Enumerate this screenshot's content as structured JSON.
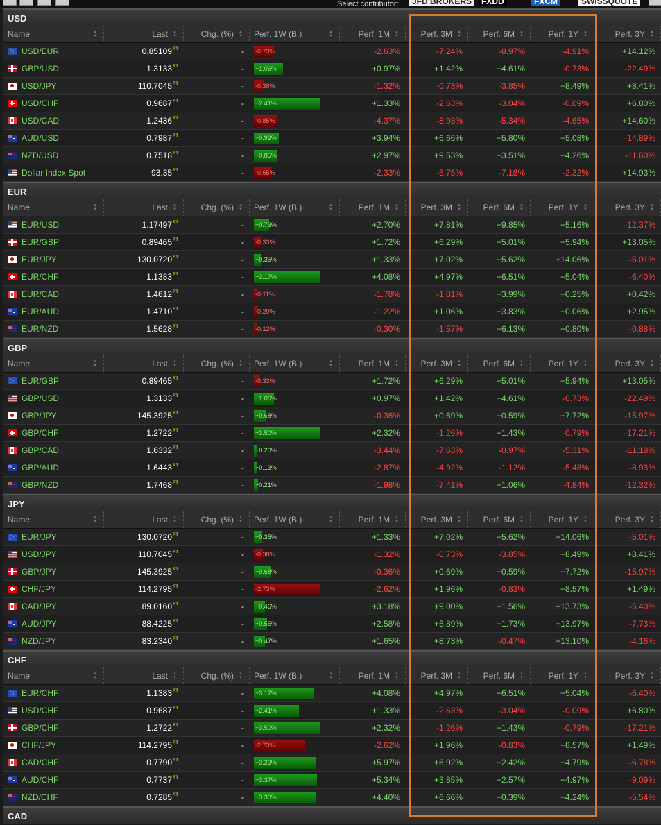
{
  "toolbar": {
    "contributor_label": "Select contributor:",
    "contributors": [
      "JFD BROKERS",
      "FXDD",
      "FXCM",
      "SWISSQUOTE"
    ]
  },
  "columns": [
    "Name",
    "Last",
    "Chg. (%)",
    "Perf. 1W (B.)",
    "Perf. 1M",
    "Perf. 3M",
    "Perf. 6M",
    "Perf. 1Y",
    "Perf. 3Y"
  ],
  "rt_label": "RT",
  "colors": {
    "up": "#79d36a",
    "down": "#ff4444",
    "highlight": "#d97b2c"
  },
  "sections": [
    {
      "title": "USD",
      "rows": [
        {
          "flag": "eu",
          "name": "USD/EUR",
          "last": "0.85109",
          "chg": "-",
          "w1": "-0.73%",
          "m1": "-2.63%",
          "m3": "-7.24%",
          "m6": "-8.97%",
          "y1": "-4.91%",
          "y3": "+14.12%"
        },
        {
          "flag": "gb",
          "name": "GBP/USD",
          "last": "1.3133",
          "chg": "-",
          "w1": "+1.06%",
          "m1": "+0.97%",
          "m3": "+1.42%",
          "m6": "+4.61%",
          "y1": "-0.73%",
          "y3": "-22.49%"
        },
        {
          "flag": "jp",
          "name": "USD/JPY",
          "last": "110.7045",
          "chg": "-",
          "w1": "-0.38%",
          "m1": "-1.32%",
          "m3": "-0.73%",
          "m6": "-3.85%",
          "y1": "+8.49%",
          "y3": "+8.41%"
        },
        {
          "flag": "ch",
          "name": "USD/CHF",
          "last": "0.9687",
          "chg": "-",
          "w1": "+2.41%",
          "m1": "+1.33%",
          "m3": "-2.63%",
          "m6": "-3.04%",
          "y1": "-0.09%",
          "y3": "+6.80%"
        },
        {
          "flag": "ca",
          "name": "USD/CAD",
          "last": "1.2436",
          "chg": "-",
          "w1": "-0.85%",
          "m1": "-4.37%",
          "m3": "-8.93%",
          "m6": "-5.34%",
          "y1": "-4.65%",
          "y3": "+14.60%"
        },
        {
          "flag": "au",
          "name": "AUD/USD",
          "last": "0.7987",
          "chg": "-",
          "w1": "+0.92%",
          "m1": "+3.94%",
          "m3": "+6.66%",
          "m6": "+5.80%",
          "y1": "+5.08%",
          "y3": "-14.89%"
        },
        {
          "flag": "nz",
          "name": "NZD/USD",
          "last": "0.7518",
          "chg": "-",
          "w1": "+0.85%",
          "m1": "+2.97%",
          "m3": "+9.53%",
          "m6": "+3.51%",
          "y1": "+4.26%",
          "y3": "-11.60%"
        },
        {
          "flag": "us",
          "name": "Dollar Index Spot",
          "last": "93.35",
          "chg": "-",
          "w1": "-0.65%",
          "m1": "-2.33%",
          "m3": "-5.75%",
          "m6": "-7.18%",
          "y1": "-2.32%",
          "y3": "+14.93%"
        }
      ]
    },
    {
      "title": "EUR",
      "rows": [
        {
          "flag": "us",
          "name": "EUR/USD",
          "last": "1.17497",
          "chg": "-",
          "w1": "+0.73%",
          "m1": "+2.70%",
          "m3": "+7.81%",
          "m6": "+9.85%",
          "y1": "+5.16%",
          "y3": "-12.37%"
        },
        {
          "flag": "gb",
          "name": "EUR/GBP",
          "last": "0.89465",
          "chg": "-",
          "w1": "-0.33%",
          "m1": "+1.72%",
          "m3": "+6.29%",
          "m6": "+5.01%",
          "y1": "+5.94%",
          "y3": "+13.05%"
        },
        {
          "flag": "jp",
          "name": "EUR/JPY",
          "last": "130.0720",
          "chg": "-",
          "w1": "+0.35%",
          "m1": "+1.33%",
          "m3": "+7.02%",
          "m6": "+5.62%",
          "y1": "+14.06%",
          "y3": "-5.01%"
        },
        {
          "flag": "ch",
          "name": "EUR/CHF",
          "last": "1.1383",
          "chg": "-",
          "w1": "+3.17%",
          "m1": "+4.08%",
          "m3": "+4.97%",
          "m6": "+6.51%",
          "y1": "+5.04%",
          "y3": "-6.40%"
        },
        {
          "flag": "ca",
          "name": "EUR/CAD",
          "last": "1.4612",
          "chg": "-",
          "w1": "-0.11%",
          "m1": "-1.78%",
          "m3": "-1.81%",
          "m6": "+3.99%",
          "y1": "+0.25%",
          "y3": "+0.42%"
        },
        {
          "flag": "au",
          "name": "EUR/AUD",
          "last": "1.4710",
          "chg": "-",
          "w1": "-0.20%",
          "m1": "-1.22%",
          "m3": "+1.06%",
          "m6": "+3.83%",
          "y1": "+0.06%",
          "y3": "+2.95%"
        },
        {
          "flag": "nz",
          "name": "EUR/NZD",
          "last": "1.5628",
          "chg": "-",
          "w1": "-0.12%",
          "m1": "-0.30%",
          "m3": "-1.57%",
          "m6": "+6.13%",
          "y1": "+0.80%",
          "y3": "-0.88%"
        }
      ]
    },
    {
      "title": "GBP",
      "rows": [
        {
          "flag": "eu",
          "name": "EUR/GBP",
          "last": "0.89465",
          "chg": "-",
          "w1": "-0.33%",
          "m1": "+1.72%",
          "m3": "+6.29%",
          "m6": "+5.01%",
          "y1": "+5.94%",
          "y3": "+13.05%"
        },
        {
          "flag": "us",
          "name": "GBP/USD",
          "last": "1.3133",
          "chg": "-",
          "w1": "+1.06%",
          "m1": "+0.97%",
          "m3": "+1.42%",
          "m6": "+4.61%",
          "y1": "-0.73%",
          "y3": "-22.49%"
        },
        {
          "flag": "jp",
          "name": "GBP/JPY",
          "last": "145.3925",
          "chg": "-",
          "w1": "+0.68%",
          "m1": "-0.36%",
          "m3": "+0.69%",
          "m6": "+0.59%",
          "y1": "+7.72%",
          "y3": "-15.97%"
        },
        {
          "flag": "ch",
          "name": "GBP/CHF",
          "last": "1.2722",
          "chg": "-",
          "w1": "+3.50%",
          "m1": "+2.32%",
          "m3": "-1.26%",
          "m6": "+1.43%",
          "y1": "-0.79%",
          "y3": "-17.21%"
        },
        {
          "flag": "ca",
          "name": "GBP/CAD",
          "last": "1.6332",
          "chg": "-",
          "w1": "+0.20%",
          "m1": "-3.44%",
          "m3": "-7.63%",
          "m6": "-0.97%",
          "y1": "-5.31%",
          "y3": "-11.18%"
        },
        {
          "flag": "au",
          "name": "GBP/AUD",
          "last": "1.6443",
          "chg": "-",
          "w1": "+0.13%",
          "m1": "-2.87%",
          "m3": "-4.92%",
          "m6": "-1.12%",
          "y1": "-5.48%",
          "y3": "-8.93%"
        },
        {
          "flag": "nz",
          "name": "GBP/NZD",
          "last": "1.7468",
          "chg": "-",
          "w1": "+0.21%",
          "m1": "-1.98%",
          "m3": "-7.41%",
          "m6": "+1.06%",
          "y1": "-4.84%",
          "y3": "-12.32%"
        }
      ]
    },
    {
      "title": "JPY",
      "rows": [
        {
          "flag": "eu",
          "name": "EUR/JPY",
          "last": "130.0720",
          "chg": "-",
          "w1": "+0.35%",
          "m1": "+1.33%",
          "m3": "+7.02%",
          "m6": "+5.62%",
          "y1": "+14.06%",
          "y3": "-5.01%"
        },
        {
          "flag": "us",
          "name": "USD/JPY",
          "last": "110.7045",
          "chg": "-",
          "w1": "-0.38%",
          "m1": "-1.32%",
          "m3": "-0.73%",
          "m6": "-3.85%",
          "y1": "+8.49%",
          "y3": "+8.41%"
        },
        {
          "flag": "gb",
          "name": "GBP/JPY",
          "last": "145.3925",
          "chg": "-",
          "w1": "+0.68%",
          "m1": "-0.36%",
          "m3": "+0.69%",
          "m6": "+0.59%",
          "y1": "+7.72%",
          "y3": "-15.97%"
        },
        {
          "flag": "ch",
          "name": "CHF/JPY",
          "last": "114.2795",
          "chg": "-",
          "w1": "-2.73%",
          "m1": "-2.62%",
          "m3": "+1.96%",
          "m6": "-0.83%",
          "y1": "+8.57%",
          "y3": "+1.49%"
        },
        {
          "flag": "ca",
          "name": "CAD/JPY",
          "last": "89.0160",
          "chg": "-",
          "w1": "+0.46%",
          "m1": "+3.18%",
          "m3": "+9.00%",
          "m6": "+1.56%",
          "y1": "+13.73%",
          "y3": "-5.40%"
        },
        {
          "flag": "au",
          "name": "AUD/JPY",
          "last": "88.4225",
          "chg": "-",
          "w1": "+0.55%",
          "m1": "+2.58%",
          "m3": "+5.89%",
          "m6": "+1.73%",
          "y1": "+13.97%",
          "y3": "-7.73%"
        },
        {
          "flag": "nz",
          "name": "NZD/JPY",
          "last": "83.2340",
          "chg": "-",
          "w1": "+0.47%",
          "m1": "+1.65%",
          "m3": "+8.73%",
          "m6": "-0.47%",
          "y1": "+13.10%",
          "y3": "-4.16%"
        }
      ]
    },
    {
      "title": "CHF",
      "rows": [
        {
          "flag": "eu",
          "name": "EUR/CHF",
          "last": "1.1383",
          "chg": "-",
          "w1": "+3.17%",
          "m1": "+4.08%",
          "m3": "+4.97%",
          "m6": "+6.51%",
          "y1": "+5.04%",
          "y3": "-6.40%"
        },
        {
          "flag": "us",
          "name": "USD/CHF",
          "last": "0.9687",
          "chg": "-",
          "w1": "+2.41%",
          "m1": "+1.33%",
          "m3": "-2.63%",
          "m6": "-3.04%",
          "y1": "-0.09%",
          "y3": "+6.80%"
        },
        {
          "flag": "gb",
          "name": "GBP/CHF",
          "last": "1.2722",
          "chg": "-",
          "w1": "+3.50%",
          "m1": "+2.32%",
          "m3": "-1.26%",
          "m6": "+1.43%",
          "y1": "-0.79%",
          "y3": "-17.21%"
        },
        {
          "flag": "jp",
          "name": "CHF/JPY",
          "last": "114.2795",
          "chg": "-",
          "w1": "-2.73%",
          "m1": "-2.62%",
          "m3": "+1.96%",
          "m6": "-0.83%",
          "y1": "+8.57%",
          "y3": "+1.49%"
        },
        {
          "flag": "ca",
          "name": "CAD/CHF",
          "last": "0.7790",
          "chg": "-",
          "w1": "+3.29%",
          "m1": "+5.97%",
          "m3": "+6.92%",
          "m6": "+2.42%",
          "y1": "+4.79%",
          "y3": "-6.78%"
        },
        {
          "flag": "au",
          "name": "AUD/CHF",
          "last": "0.7737",
          "chg": "-",
          "w1": "+3.37%",
          "m1": "+5.34%",
          "m3": "+3.85%",
          "m6": "+2.57%",
          "y1": "+4.97%",
          "y3": "-9.09%"
        },
        {
          "flag": "nz",
          "name": "NZD/CHF",
          "last": "0.7285",
          "chg": "-",
          "w1": "+3.30%",
          "m1": "+4.40%",
          "m3": "+6.66%",
          "m6": "+0.39%",
          "y1": "+4.24%",
          "y3": "-5.54%"
        }
      ]
    },
    {
      "title": "CAD",
      "rows": []
    }
  ]
}
